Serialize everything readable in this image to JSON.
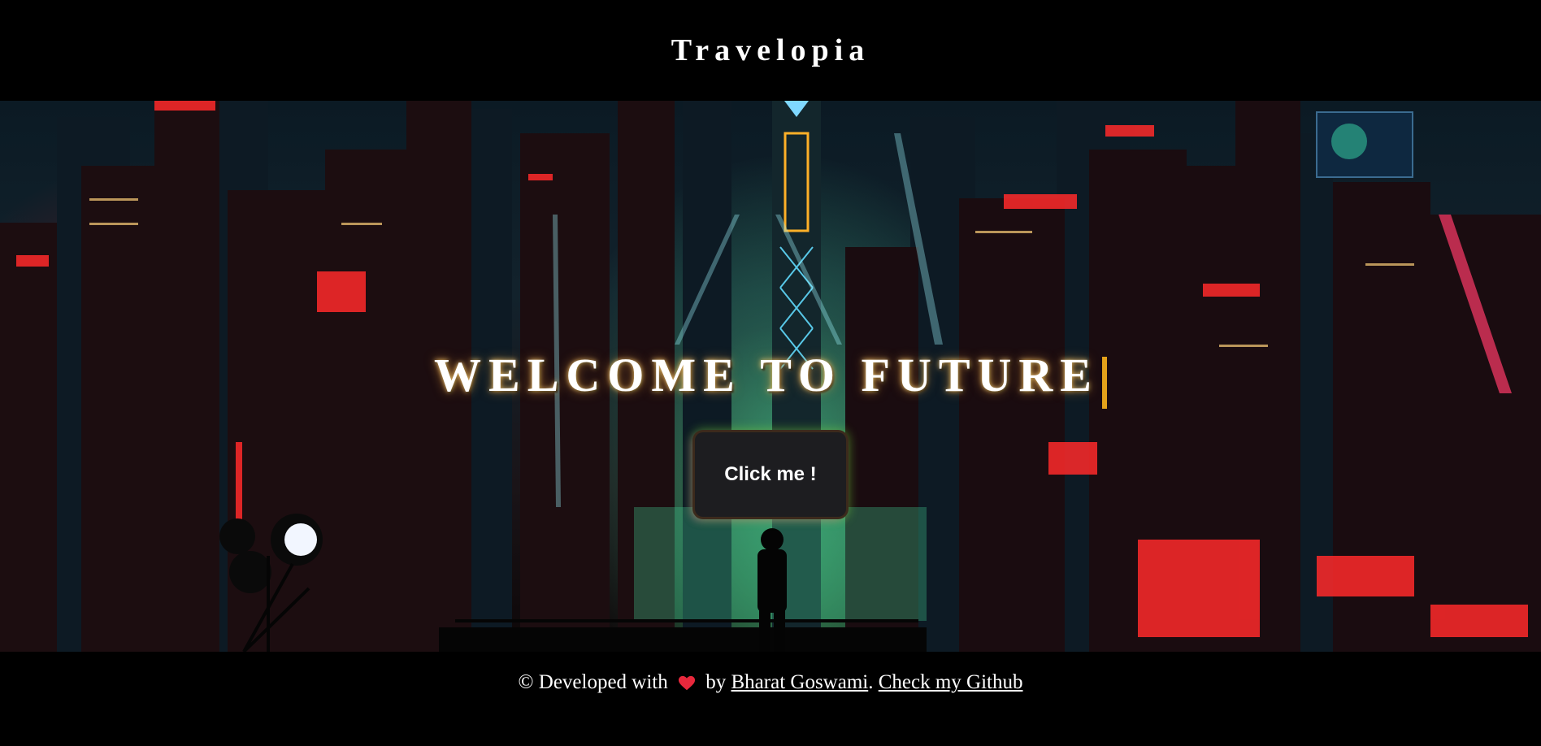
{
  "header": {
    "brand": "Travelopia"
  },
  "hero": {
    "headline": "WELCOME TO FUTURE",
    "cta_label": "Click me !",
    "background_image": "neon cyberpunk city skyline at night with a silhouetted figure on a rooftop",
    "accent_color": "#e4a21a"
  },
  "footer": {
    "prefix": "© Developed with",
    "heart_icon": "heart-icon",
    "by": "by",
    "author_link": "Bharat Goswami",
    "separator": ".",
    "github_link": "Check my Github"
  }
}
